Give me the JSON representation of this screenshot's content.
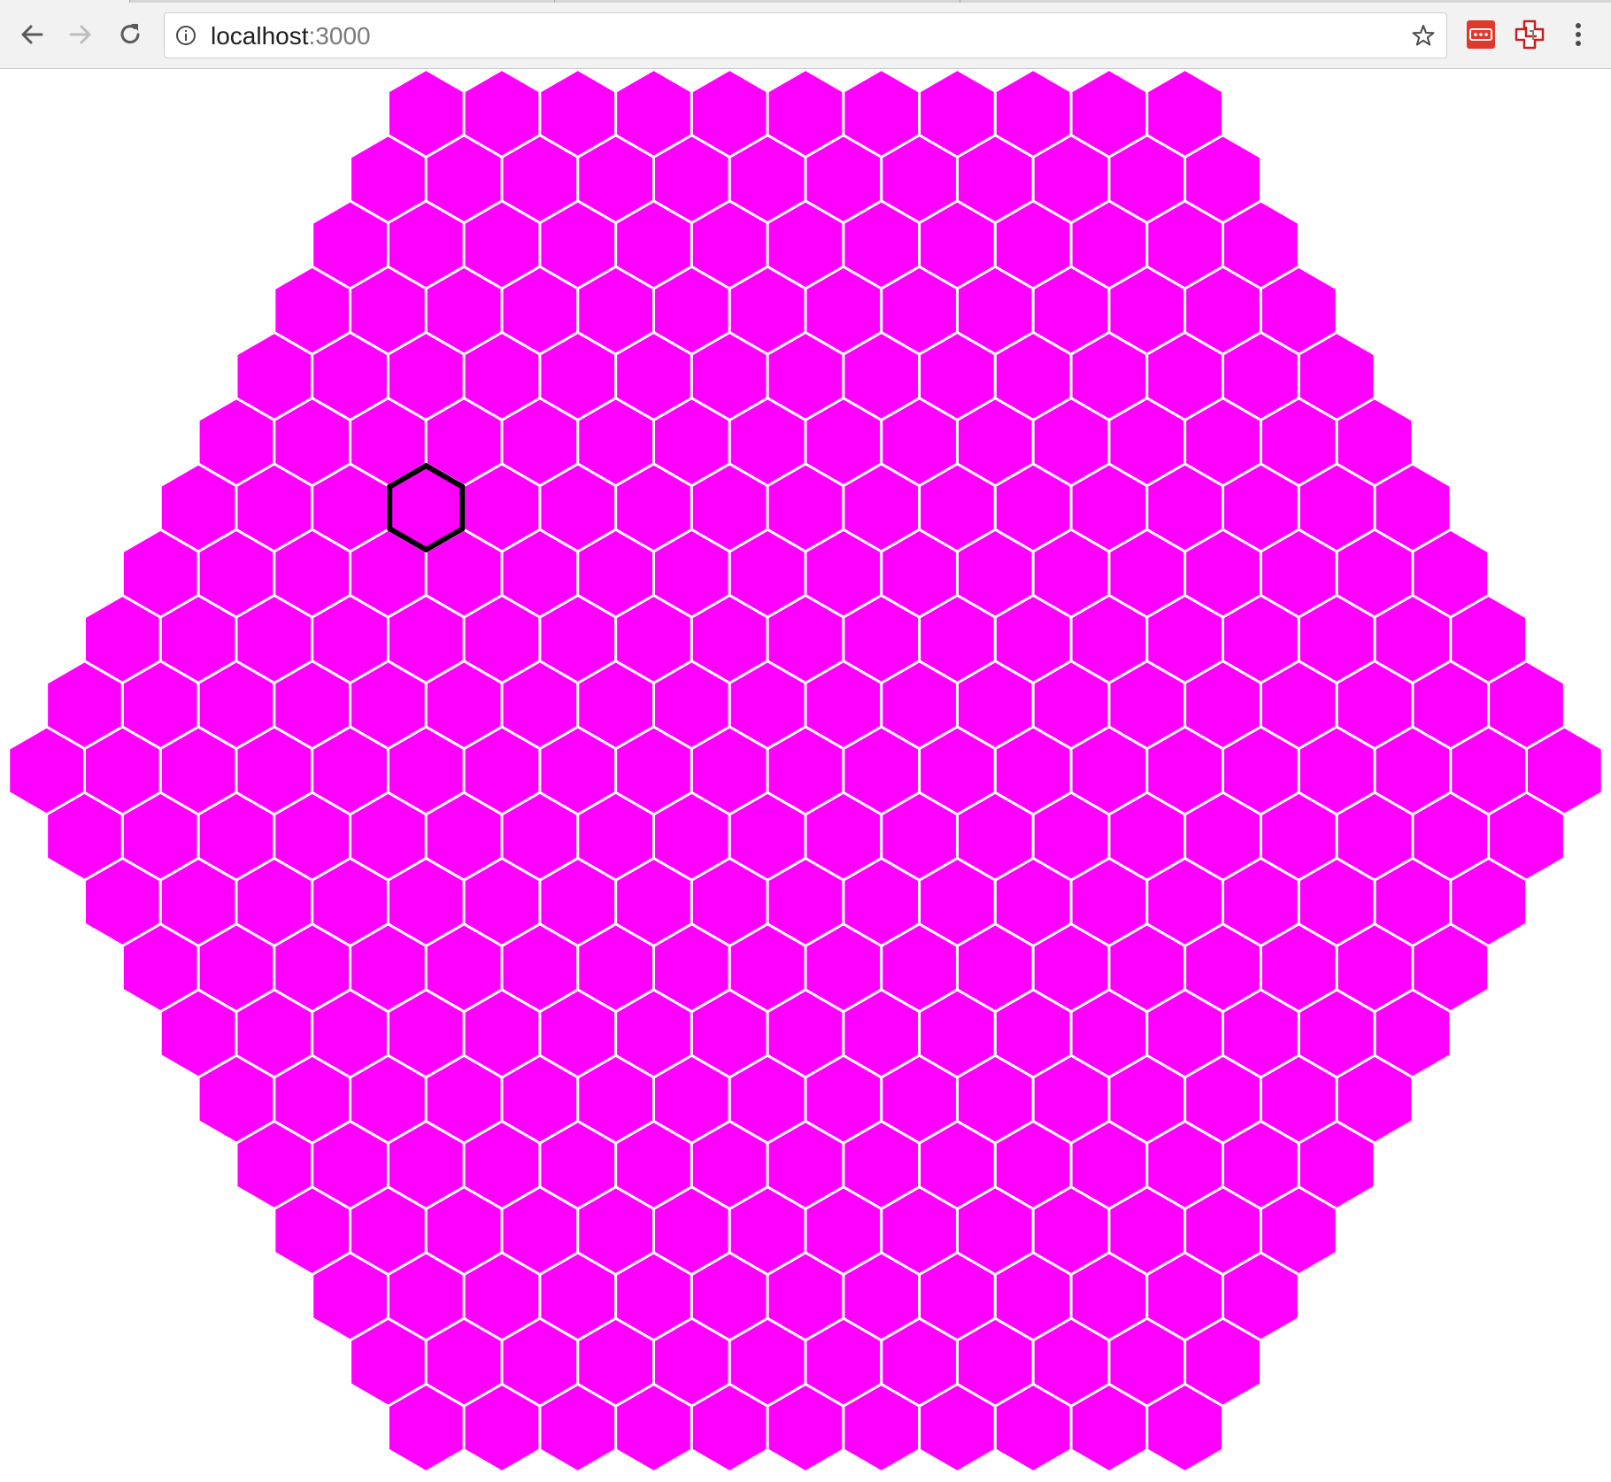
{
  "browser": {
    "url_host": "localhost",
    "url_port": ":3000",
    "icons": {
      "back": "arrow-left-icon",
      "forward": "arrow-right-icon",
      "reload": "reload-icon",
      "site_info": "info-circle-icon",
      "bookmark": "star-outline-icon",
      "extension_password": "password-manager-icon",
      "extension_clipper": "clipper-extension-icon",
      "menu": "vertical-ellipsis-icon"
    },
    "colors": {
      "toolbar": "#f2f2f2",
      "extension_password": "#e0392b",
      "extension_clipper": "#c81e1e"
    }
  },
  "hex_board": {
    "shape": "hexagon",
    "side_length": 11,
    "cell_count": 331,
    "row_lengths": [
      11,
      12,
      13,
      14,
      15,
      16,
      17,
      18,
      19,
      20,
      21,
      20,
      19,
      18,
      17,
      16,
      15,
      14,
      13,
      12,
      11
    ],
    "selected_cell": {
      "row": 6,
      "index": 3
    },
    "colors": {
      "cell_fill": "#ff00ff",
      "cell_border": "#ffffff",
      "selected_outline": "#000000",
      "background": "#ffffff"
    }
  }
}
